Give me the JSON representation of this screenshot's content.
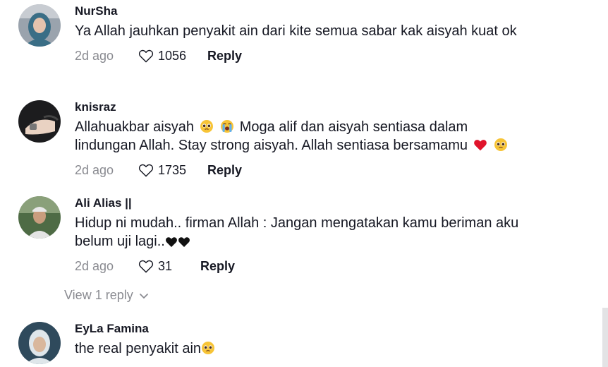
{
  "comments": [
    {
      "username": "NurSha",
      "text": "Ya Allah jauhkan penyakit ain dari kite semua sabar kak aisyah kuat ok",
      "date": "2d ago",
      "likes": "1056",
      "reply_label": "Reply"
    },
    {
      "username": "knisraz",
      "text_parts": [
        "Allahuakbar aisyah",
        "Moga alif dan aisyah sentiasa dalam lindungan Allah. Stay strong aisyah. Allah sentiasa bersamamu"
      ],
      "date": "2d ago",
      "likes": "1735",
      "reply_label": "Reply"
    },
    {
      "username": "Ali Alias ||",
      "text": "Hidup ni mudah.. firman Allah : Jangan mengatakan kamu beriman aku belum uji lagi..",
      "date": "2d ago",
      "likes": "31",
      "reply_label": "Reply",
      "view_replies_label": "View 1 reply"
    },
    {
      "username": "EyLa Famina",
      "text": "the real penyakit ain"
    }
  ],
  "icons": {
    "like": "heart-outline-icon",
    "expand": "chevron-down-icon",
    "emoji_pleading": "pleading-face-icon",
    "emoji_crying": "loudly-crying-face-icon",
    "emoji_heart_red": "red-heart-icon",
    "emoji_heart_black": "black-heart-icon"
  },
  "colors": {
    "text": "#161823",
    "secondary": "#8a8b91",
    "heart_red": "#e0142b"
  }
}
